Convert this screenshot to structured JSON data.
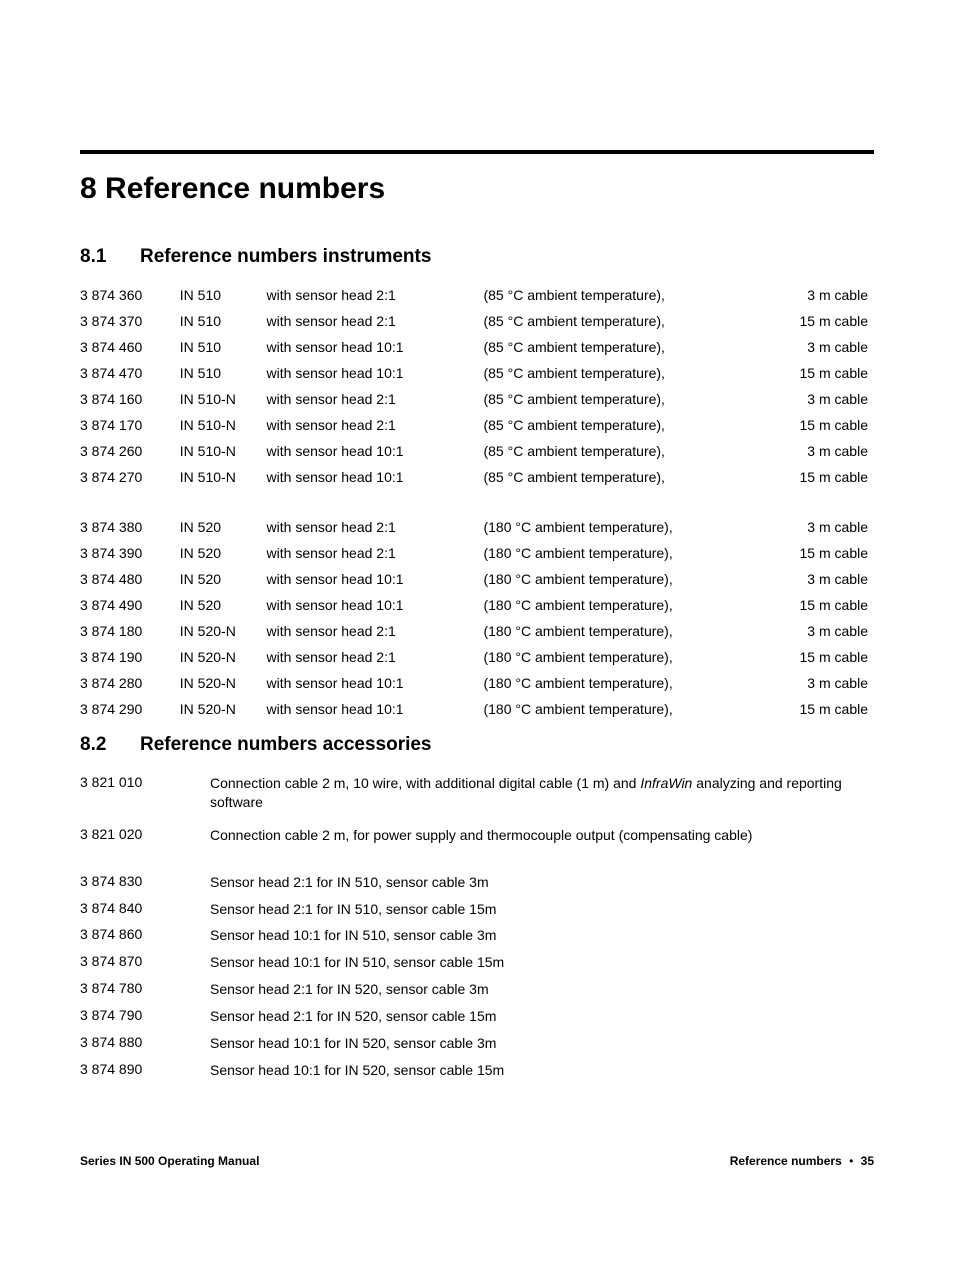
{
  "chapter": {
    "number": "8",
    "title": "Reference numbers"
  },
  "section1": {
    "number": "8.1",
    "title": "Reference numbers instruments"
  },
  "section2": {
    "number": "8.2",
    "title": "Reference numbers accessories"
  },
  "instruments_group1": [
    {
      "ref": "3 874 360",
      "model": "IN 510",
      "head": "with sensor head 2:1",
      "temp": "(85 °C ambient temperature),",
      "cable": "3 m cable"
    },
    {
      "ref": "3 874 370",
      "model": "IN 510",
      "head": "with sensor head 2:1",
      "temp": "(85 °C ambient temperature),",
      "cable": "15 m cable"
    },
    {
      "ref": "3 874 460",
      "model": "IN 510",
      "head": "with sensor head 10:1",
      "temp": "(85 °C ambient temperature),",
      "cable": "3 m cable"
    },
    {
      "ref": "3 874 470",
      "model": "IN 510",
      "head": "with sensor head 10:1",
      "temp": "(85 °C ambient temperature),",
      "cable": "15 m cable"
    },
    {
      "ref": "3 874 160",
      "model": "IN 510-N",
      "head": "with sensor head 2:1",
      "temp": "(85 °C ambient temperature),",
      "cable": "3 m cable"
    },
    {
      "ref": "3 874 170",
      "model": "IN 510-N",
      "head": "with sensor head 2:1",
      "temp": "(85 °C ambient temperature),",
      "cable": "15 m cable"
    },
    {
      "ref": "3 874 260",
      "model": "IN 510-N",
      "head": "with sensor head 10:1",
      "temp": "(85 °C ambient temperature),",
      "cable": "3 m cable"
    },
    {
      "ref": "3 874 270",
      "model": "IN 510-N",
      "head": "with sensor head 10:1",
      "temp": "(85 °C ambient temperature),",
      "cable": "15 m cable"
    }
  ],
  "instruments_group2": [
    {
      "ref": "3 874 380",
      "model": "IN 520",
      "head": "with sensor head 2:1",
      "temp": "(180 °C ambient temperature),",
      "cable": "3 m cable"
    },
    {
      "ref": "3 874 390",
      "model": "IN 520",
      "head": "with sensor head 2:1",
      "temp": "(180 °C ambient temperature),",
      "cable": "15 m cable"
    },
    {
      "ref": "3 874 480",
      "model": "IN 520",
      "head": "with sensor head 10:1",
      "temp": "(180 °C ambient temperature),",
      "cable": "3 m cable"
    },
    {
      "ref": "3 874 490",
      "model": "IN 520",
      "head": "with sensor head 10:1",
      "temp": "(180 °C ambient temperature),",
      "cable": "15 m cable"
    },
    {
      "ref": "3 874 180",
      "model": "IN 520-N",
      "head": "with sensor head 2:1",
      "temp": "(180 °C ambient temperature),",
      "cable": "3 m cable"
    },
    {
      "ref": "3 874 190",
      "model": "IN 520-N",
      "head": "with sensor head 2:1",
      "temp": "(180 °C ambient temperature),",
      "cable": "15 m cable"
    },
    {
      "ref": "3 874 280",
      "model": "IN 520-N",
      "head": "with sensor head 10:1",
      "temp": "(180 °C ambient temperature),",
      "cable": "3 m cable"
    },
    {
      "ref": "3 874 290",
      "model": "IN 520-N",
      "head": "with sensor head 10:1",
      "temp": "(180 °C ambient temperature),",
      "cable": "15 m cable"
    }
  ],
  "accessories_top": [
    {
      "ref": "3 821 010",
      "desc_prefix": "Connection cable 2 m, 10 wire, with additional digital cable (1 m) and ",
      "italic": "InfraWin",
      "desc_suffix": " analyzing and reporting software"
    },
    {
      "ref": "3 821 020",
      "desc_prefix": "Connection cable 2 m, for power supply and thermocouple output (compensating cable)",
      "italic": "",
      "desc_suffix": ""
    }
  ],
  "accessories_heads": [
    {
      "ref": "3 874 830",
      "desc": "Sensor head 2:1 for IN 510, sensor cable 3m"
    },
    {
      "ref": "3 874 840",
      "desc": "Sensor head 2:1 for IN 510, sensor cable 15m"
    },
    {
      "ref": "3 874 860",
      "desc": "Sensor head 10:1 for IN 510, sensor cable 3m"
    },
    {
      "ref": "3 874 870",
      "desc": "Sensor head 10:1 for IN 510, sensor cable 15m"
    },
    {
      "ref": "3 874 780",
      "desc": "Sensor head 2:1 for IN 520, sensor cable 3m"
    },
    {
      "ref": "3 874 790",
      "desc": "Sensor head 2:1 for IN 520, sensor cable 15m"
    },
    {
      "ref": "3 874 880",
      "desc": "Sensor head 10:1 for IN 520, sensor cable 3m"
    },
    {
      "ref": "3 874 890",
      "desc": "Sensor head 10:1 for IN 520, sensor cable 15m"
    }
  ],
  "footer": {
    "left": "Series IN 500 Operating Manual",
    "right_title": "Reference numbers",
    "bullet": "•",
    "page": "35"
  }
}
